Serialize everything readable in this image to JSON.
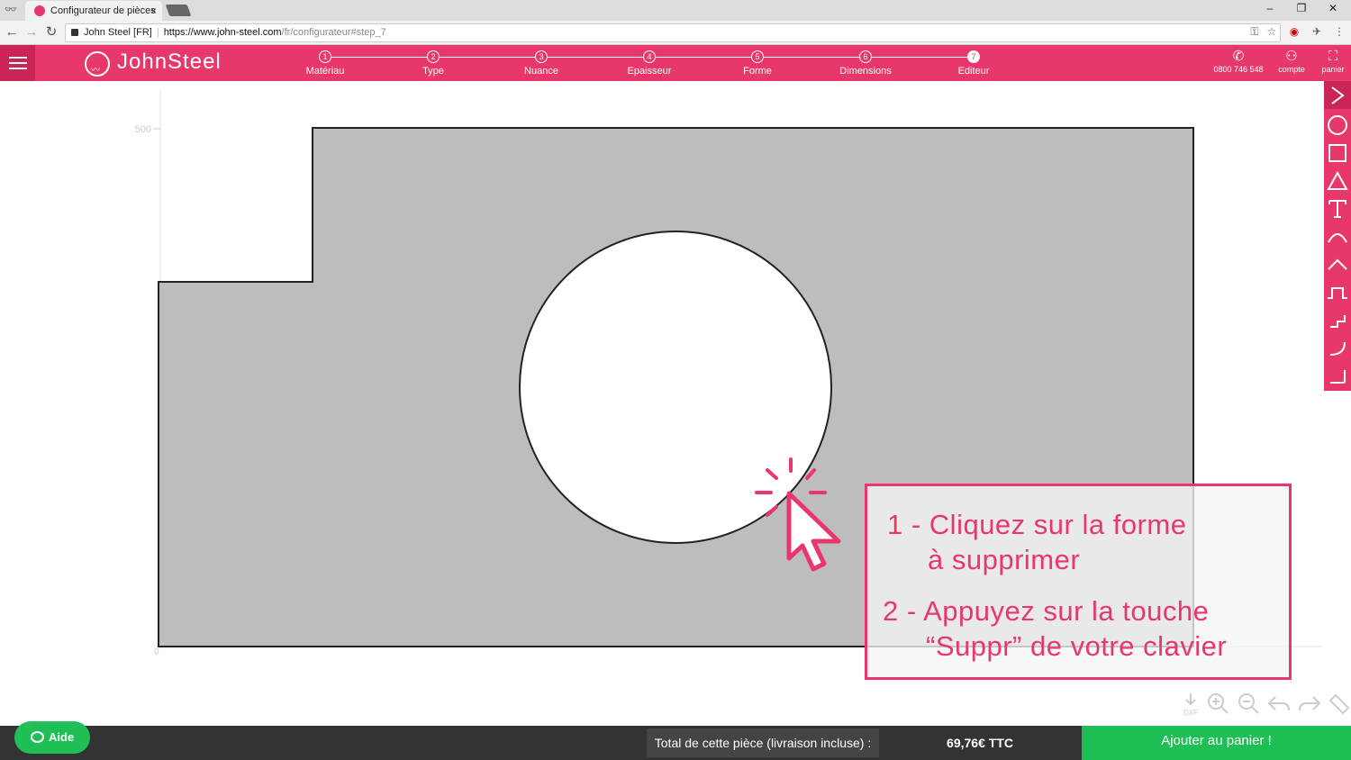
{
  "browser": {
    "tab_title": "Configurateur de pièces",
    "tab_close": "×",
    "incognito_icon": "👓",
    "url_site_label": "John Steel [FR]",
    "url_scheme": "https://",
    "url_host": "www.john-steel.com",
    "url_path": "/fr/configurateur#step_7",
    "window_controls": [
      "–",
      "❐",
      "✕"
    ]
  },
  "header": {
    "logo_text": "JohnSteel",
    "steps": [
      {
        "num": "1",
        "label": "Matériau"
      },
      {
        "num": "2",
        "label": "Type"
      },
      {
        "num": "3",
        "label": "Nuance"
      },
      {
        "num": "4",
        "label": "Epaisseur"
      },
      {
        "num": "5",
        "label": "Forme"
      },
      {
        "num": "6",
        "label": "Dimensions"
      },
      {
        "num": "7",
        "label": "Editeur"
      }
    ],
    "active_step": 7,
    "phone": "0800 746 548",
    "account": "compte",
    "cart": "panier"
  },
  "canvas": {
    "axis_label_top": "500",
    "axis_label_origin": "0"
  },
  "toolbar_icons": [
    "chevron-right-icon",
    "circle-icon",
    "square-icon",
    "triangle-icon",
    "text-icon",
    "arc-icon",
    "chamfer-peak-icon",
    "notch-icon",
    "step-corner-icon",
    "rounded-corner-icon",
    "corner-icon"
  ],
  "bottom_tools": [
    "download-dxf-icon",
    "zoom-in-icon",
    "zoom-out-icon",
    "undo-icon",
    "redo-icon",
    "ruler-icon"
  ],
  "bottom_tools_dxf_label": "DXF",
  "footer": {
    "aide": "Aide",
    "total_label": "Total de cette pièce (livraison incluse) :",
    "price": "69,76€ TTC",
    "add_to_cart": "Ajouter au panier !"
  },
  "instructions": {
    "line1": "1 - Cliquez sur la forme",
    "line1b": "à supprimer",
    "line2": "2 - Appuyez sur la touche",
    "line2b": "“Suppr” de votre clavier"
  },
  "colors": {
    "brand": "#e8386b",
    "green": "#1fbf55",
    "shape_fill": "#bdbdbd"
  }
}
